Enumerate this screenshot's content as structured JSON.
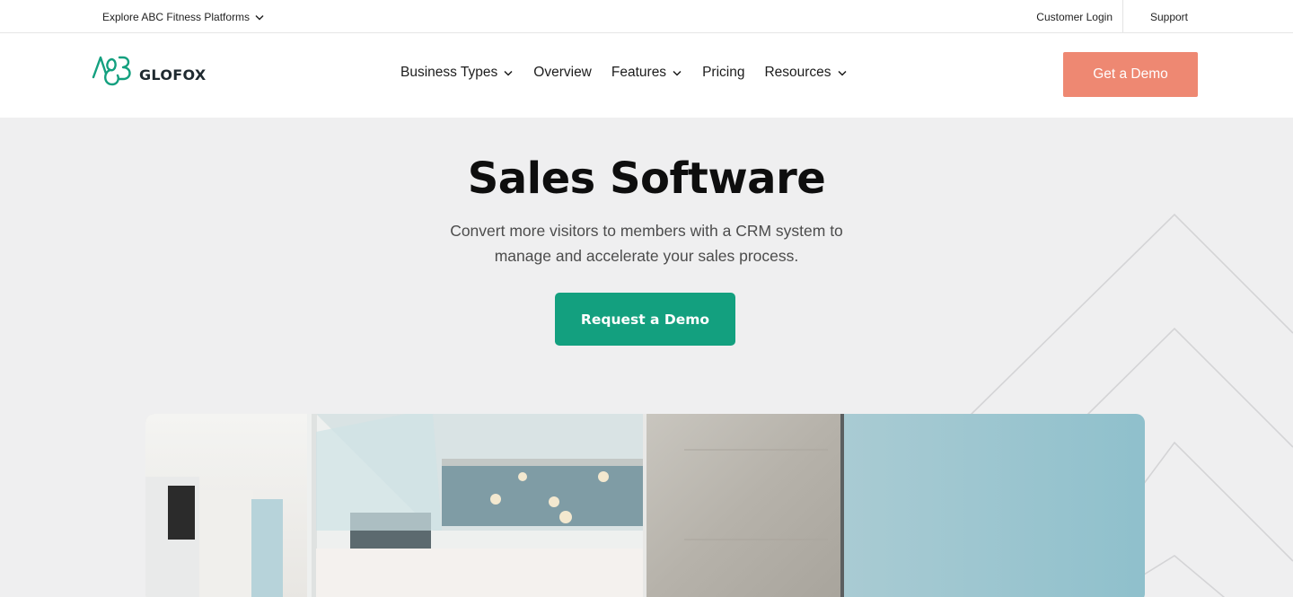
{
  "topbar": {
    "explore_label": "Explore ABC Fitness Platforms",
    "customer_login": "Customer Login",
    "support": "Support"
  },
  "brand": {
    "logo_text": "GLOFOX",
    "logo_mark": "ABC",
    "primary_green": "#13a07f",
    "accent_coral": "#ee8872"
  },
  "nav": {
    "items": [
      {
        "label": "Business Types",
        "has_dropdown": true
      },
      {
        "label": "Overview",
        "has_dropdown": false
      },
      {
        "label": "Features",
        "has_dropdown": true
      },
      {
        "label": "Pricing",
        "has_dropdown": false
      },
      {
        "label": "Resources",
        "has_dropdown": true
      }
    ],
    "cta_label": "Get a Demo"
  },
  "hero": {
    "title": "Sales Software",
    "subtitle": "Convert more visitors to members with a CRM system to manage and accelerate your sales process.",
    "cta_label": "Request a Demo",
    "image_icon": "gym-interior-photo"
  }
}
